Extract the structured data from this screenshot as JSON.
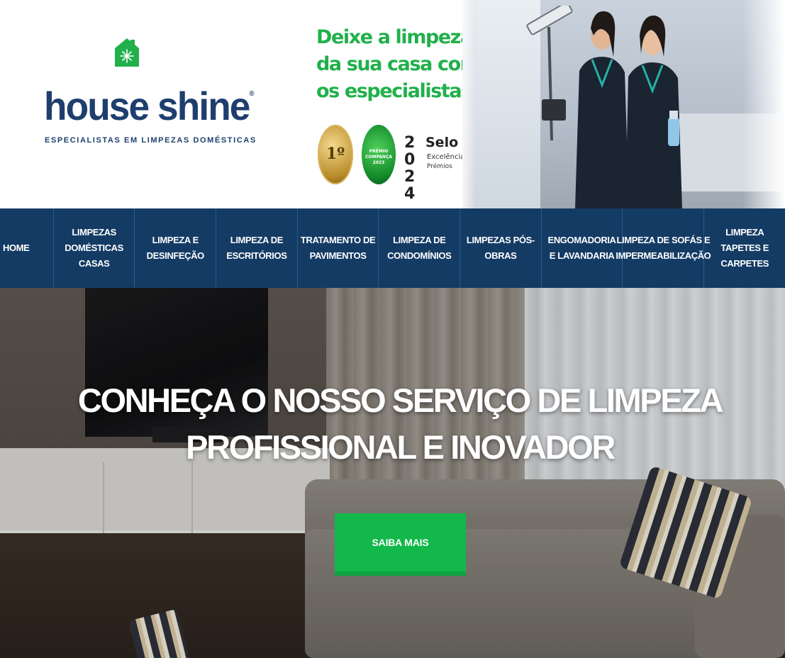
{
  "brand": {
    "name": "house shine",
    "registered": "®",
    "tagline": "ESPECIALISTAS EM LIMPEZAS DOMÉSTICAS",
    "color_primary": "#1e3f6e",
    "color_accent": "#21b04b"
  },
  "promo": {
    "lines": [
      "Deixe a limpeza",
      "da sua casa com",
      "os especialistas."
    ]
  },
  "badges": {
    "gold": "1º",
    "green": "PRÉMIO COMPANÇA 2023",
    "selo_year": "2024",
    "selo_title": "Selo",
    "selo_text1": "Excelência",
    "selo_text2": "Prémios"
  },
  "nav": {
    "items": [
      {
        "label": "HOME"
      },
      {
        "label": "LIMPEZAS DOMÉSTICAS CASAS"
      },
      {
        "label": "LIMPEZA E DESINFEÇÃO"
      },
      {
        "label": "LIMPEZA DE ESCRITÓRIOS"
      },
      {
        "label": "TRATAMENTO DE PAVIMENTOS"
      },
      {
        "label": "LIMPEZA DE CONDOMÍNIOS"
      },
      {
        "label": "LIMPEZAS PÓS-OBRAS"
      },
      {
        "label": "ENGOMADORIA E LAVANDARIA"
      },
      {
        "label": "LIMPEZA DE SOFÁS E IMPERMEABILIZAÇÃO"
      },
      {
        "label": "LIMPEZA TAPETES E CARPETES"
      }
    ],
    "color_bg": "#143b64"
  },
  "hero": {
    "title_line1": "CONHEÇA O NOSSO SERVIÇO DE LIMPEZA",
    "title_line2": "PROFISSIONAL E INOVADOR",
    "cta_label": "SAIBA MAIS",
    "cta_color": "#12b84a"
  }
}
